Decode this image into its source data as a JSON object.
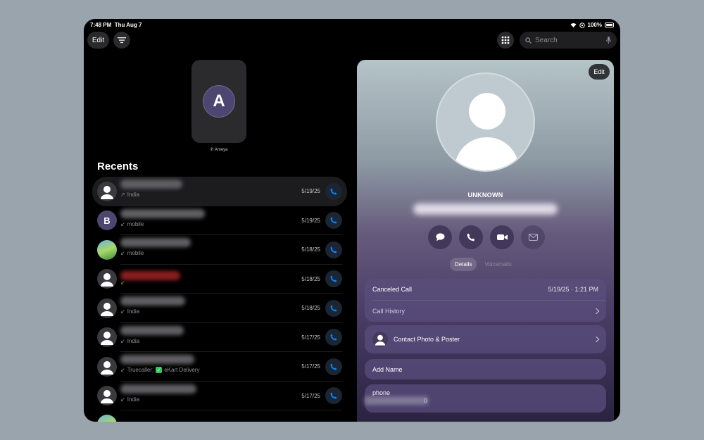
{
  "status_bar": {
    "time": "7:48 PM",
    "date": "Thu Aug 7",
    "battery": "100%"
  },
  "toolbar": {
    "edit_label": "Edit",
    "search_placeholder": "Search"
  },
  "favorite": {
    "initial": "A",
    "label": "Ameya"
  },
  "recents": {
    "title": "Recents",
    "rows": [
      {
        "sub": "India",
        "direction": "↗",
        "date": "5/19/25"
      },
      {
        "sub": "mobile",
        "direction": "↙",
        "date": "5/19/25",
        "initial": "B"
      },
      {
        "sub": "mobile",
        "direction": "↙",
        "date": "5/18/25"
      },
      {
        "sub": "",
        "direction": "↙",
        "date": "5/18/25"
      },
      {
        "sub": "India",
        "direction": "↙",
        "date": "5/18/25"
      },
      {
        "sub": "India",
        "direction": "↙",
        "date": "5/17/25"
      },
      {
        "sub": "Truecaller: ",
        "badge": "✓",
        "sub2": "eKart Delivery",
        "direction": "↙",
        "date": "5/17/25"
      },
      {
        "sub": "India",
        "direction": "↙",
        "date": "5/17/25"
      }
    ]
  },
  "detail": {
    "edit_label": "Edit",
    "caller_name": "UNKNOWN",
    "tabs": [
      "Details",
      "Voicemails"
    ],
    "call_card": {
      "status": "Canceled Call",
      "timestamp": "5/19/25 · 1:21 PM",
      "history_label": "Call History"
    },
    "photo_poster_label": "Contact Photo & Poster",
    "add_name_label": "Add Name",
    "phone_label": "phone",
    "phone_tail": "0"
  },
  "colors": {
    "accent": "#0a84ff",
    "background": "#000000"
  }
}
